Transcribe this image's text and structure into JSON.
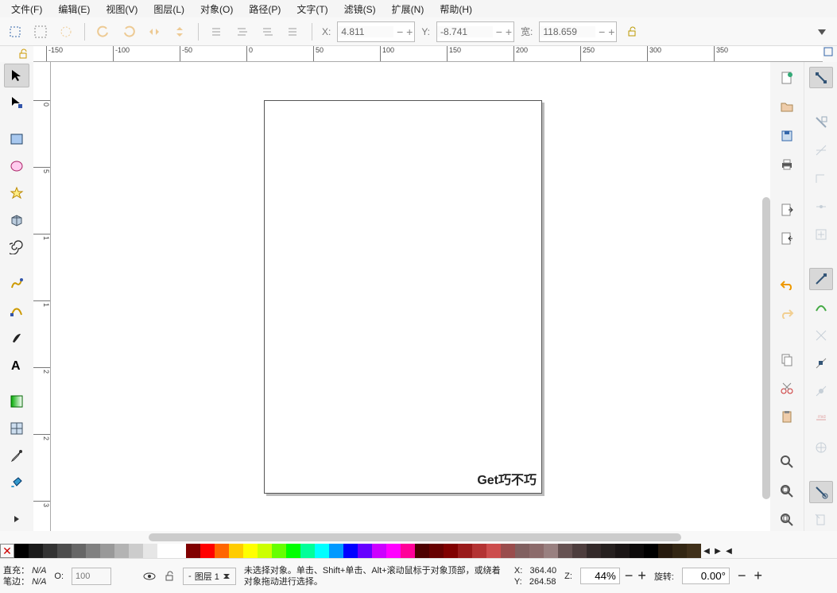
{
  "menu": {
    "file": "文件(F)",
    "edit": "编辑(E)",
    "view": "视图(V)",
    "layer": "图层(L)",
    "object": "对象(O)",
    "path": "路径(P)",
    "text": "文字(T)",
    "filter": "滤镜(S)",
    "ext": "扩展(N)",
    "help": "帮助(H)"
  },
  "toolbar": {
    "x_label": "X:",
    "y_label": "Y:",
    "w_label": "宽:",
    "x": "4.811",
    "y": "-8.741",
    "w": "118.659"
  },
  "ruler": {
    "h": [
      "-150",
      "-100",
      "-50",
      "0",
      "50",
      "100",
      "150",
      "200",
      "250",
      "300",
      "350"
    ],
    "v": [
      "0",
      "5",
      "1",
      "1",
      "2",
      "2",
      "3"
    ]
  },
  "canvas": {
    "page_text": "Get巧不巧"
  },
  "status": {
    "fill_label": "直充：",
    "stroke_label": "笔边：",
    "fill": "N/A",
    "stroke": "N/A",
    "o_label": "O:",
    "opacity": "100",
    "layer_prefix": "-",
    "layer": "图层 1",
    "msg": "未选择对象。单击、Shift+单击、Alt+滚动鼠标于对象顶部，或绕着对象拖动进行选择。",
    "coord_x_label": "X:",
    "coord_y_label": "Y:",
    "coord_x": "364.40",
    "coord_y": "264.58",
    "z_label": "Z:",
    "zoom": "44%",
    "rotate_label": "旋转:",
    "rotate": "0.00°"
  },
  "palette_grays": [
    "#000000",
    "#1a1a1a",
    "#333333",
    "#4d4d4d",
    "#666666",
    "#808080",
    "#999999",
    "#b3b3b3",
    "#cccccc",
    "#e6e6e6",
    "#ffffff"
  ],
  "palette_colors": [
    "#800000",
    "#ff0000",
    "#ff6600",
    "#ffcc00",
    "#ffff00",
    "#ccff00",
    "#66ff00",
    "#00ff00",
    "#00ff99",
    "#00ffff",
    "#0099ff",
    "#0000ff",
    "#6600ff",
    "#cc00ff",
    "#ff00ff",
    "#ff0099",
    "#4d0000",
    "#660000",
    "#800000",
    "#991a1a",
    "#b33333",
    "#cc4d4d",
    "#994d4d",
    "#806060",
    "#8c6b6b",
    "#998080",
    "#665252",
    "#4d3d3d",
    "#332929",
    "#26201f",
    "#1a1515",
    "#0d0b0b",
    "#000000",
    "#261a0d",
    "#332613",
    "#40301a"
  ]
}
